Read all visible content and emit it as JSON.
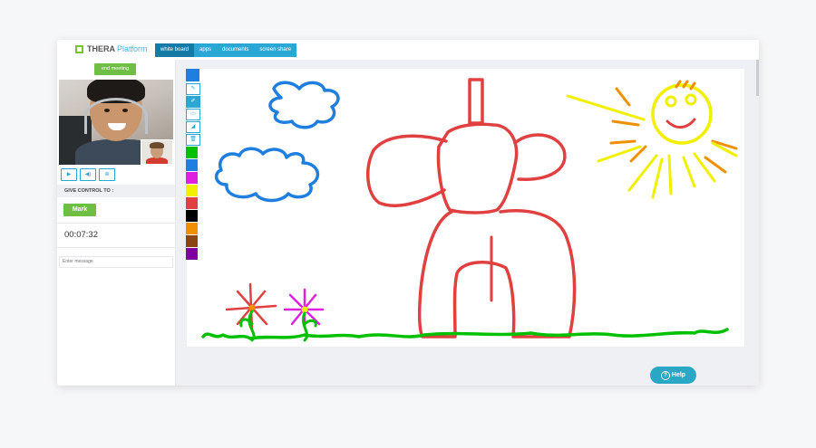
{
  "app": {
    "logo_text": "THERA",
    "logo_text_2": "Platform"
  },
  "tabs": [
    {
      "label": "white board",
      "active": true
    },
    {
      "label": "apps",
      "active": false
    },
    {
      "label": "documents",
      "active": false
    },
    {
      "label": "screen share",
      "active": false
    }
  ],
  "sidebar": {
    "end_meeting": "end meeting",
    "controls": [
      {
        "icon": "camera-icon",
        "glyph": "▶"
      },
      {
        "icon": "speaker-icon",
        "glyph": "◀)"
      },
      {
        "icon": "zoom-icon",
        "glyph": "⊕"
      }
    ],
    "give_control_label": "GIVE CONTROL TO :",
    "participant_button": "Mark",
    "timer": "00:07:32",
    "message_placeholder": "Enter message"
  },
  "whiteboard": {
    "tools": [
      {
        "icon": "pencil-icon",
        "glyph": "✎",
        "selected": false
      },
      {
        "icon": "brush-icon",
        "glyph": "✐",
        "selected": true
      },
      {
        "icon": "text-icon",
        "glyph": "▭",
        "selected": false
      },
      {
        "icon": "eraser-icon",
        "glyph": "◢",
        "selected": false
      },
      {
        "icon": "trash-icon",
        "glyph": "🗑",
        "selected": false
      }
    ],
    "colors": [
      "#1e7fe0",
      "#00c000",
      "#1e7fe0",
      "#e020e0",
      "#f0f000",
      "#e04040",
      "#000000",
      "#f09000",
      "#8b4513",
      "#8000a0"
    ]
  },
  "help": {
    "label": "Help"
  }
}
